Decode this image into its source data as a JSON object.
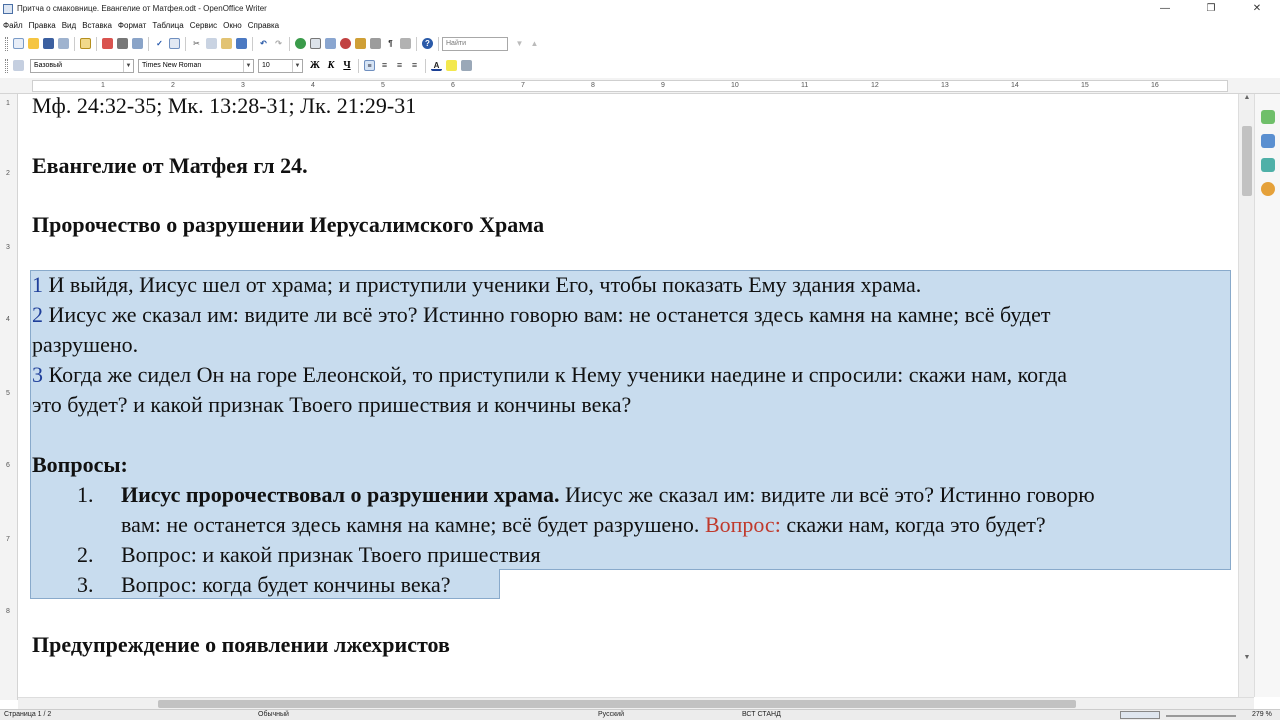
{
  "window": {
    "title": "Притча о смаковнице. Евангелие от Матфея.odt - OpenOffice Writer",
    "controls": [
      "—",
      "❐",
      "✕"
    ]
  },
  "menu": [
    "Файл",
    "Правка",
    "Вид",
    "Вставка",
    "Формат",
    "Таблица",
    "Сервис",
    "Окно",
    "Справка"
  ],
  "toolbar": {
    "find_placeholder": "Найти"
  },
  "formatting": {
    "style": "Базовый",
    "font": "Times New Roman",
    "size": "10",
    "bold": "Ж",
    "italic": "К",
    "underline": "Ч"
  },
  "ruler": {
    "marks": [
      "1",
      "1",
      "2",
      "3",
      "4",
      "5",
      "6",
      "7",
      "8",
      "9",
      "10",
      "11",
      "12",
      "13",
      "14",
      "15",
      "16"
    ],
    "vmarks": [
      "1",
      "2",
      "3",
      "4",
      "5",
      "6",
      "7",
      "8"
    ]
  },
  "document": {
    "refs": "Мф. 24:32-35; Мк. 13:28-31; Лк. 21:29-31",
    "heading1": "Евангелие от Матфея гл 24.",
    "heading2": "Пророчество о разрушении Иерусалимского Храма",
    "verses": [
      {
        "num": "1",
        "text": " И выйдя, Иисус шел от храма; и приступили ученики Его, чтобы показать Ему здания храма."
      },
      {
        "num": "2",
        "text": " Иисус же сказал им: видите ли всё это? Истинно говорю вам: не останется здесь камня на камне; всё будет",
        "cont": "разрушено."
      },
      {
        "num": "3",
        "text": " Когда же сидел Он на горе Елеонской, то приступили к Нему ученики наедине и спросили: скажи нам, когда",
        "cont": "это будет? и какой признак Твоего пришествия и кончины века?"
      }
    ],
    "questions_heading": "Вопросы:",
    "questions": [
      {
        "num": "1.",
        "bold": "Иисус пророчествовал о разрушении храма.",
        "text": " Иисус же сказал им: видите ли всё это? Истинно говорю",
        "cont": "вам: не останется здесь камня на камне; всё будет разрушено. ",
        "red": "Вопрос:",
        "after": " скажи нам, когда это будет?"
      },
      {
        "num": "2.",
        "text": "Вопрос:  и какой признак Твоего пришествия"
      },
      {
        "num": "3.",
        "text": "Вопрос:  когда будет кончины века?"
      }
    ],
    "heading3": "Предупреждение о появлении лжехристов"
  },
  "status": {
    "page": "Страница 1 / 2",
    "style": "Обычный",
    "lang": "Русский",
    "mode": "ВСТ  СТАНД",
    "zoom": "279 %"
  }
}
